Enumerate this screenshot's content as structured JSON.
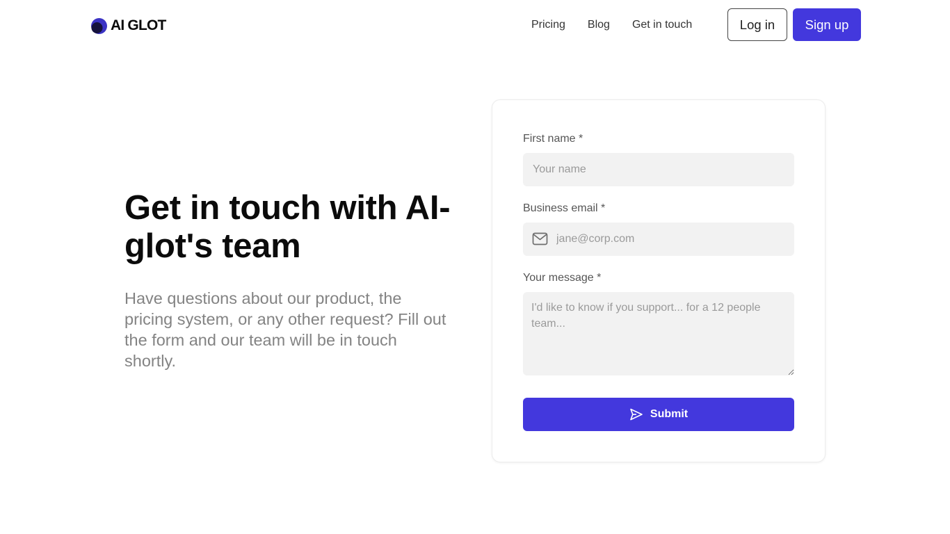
{
  "brand": {
    "name": "AI GLOT",
    "accent_color": "#4338dd"
  },
  "nav": {
    "links": [
      {
        "label": "Pricing"
      },
      {
        "label": "Blog"
      },
      {
        "label": "Get in touch"
      }
    ],
    "login_label": "Log in",
    "signup_label": "Sign up"
  },
  "hero": {
    "title": "Get in touch with AI-glot's team",
    "subtitle": "Have questions about our product, the pricing system, or any other request? Fill out the form and our team will be in touch shortly."
  },
  "form": {
    "first_name": {
      "label": "First name *",
      "placeholder": "Your name",
      "value": ""
    },
    "email": {
      "label": "Business email *",
      "placeholder": "jane@corp.com",
      "value": "",
      "icon": "mail-icon"
    },
    "message": {
      "label": "Your message *",
      "placeholder": "I'd like to know if you support... for a 12 people team...",
      "value": ""
    },
    "submit_label": "Submit",
    "submit_icon": "send-icon"
  }
}
